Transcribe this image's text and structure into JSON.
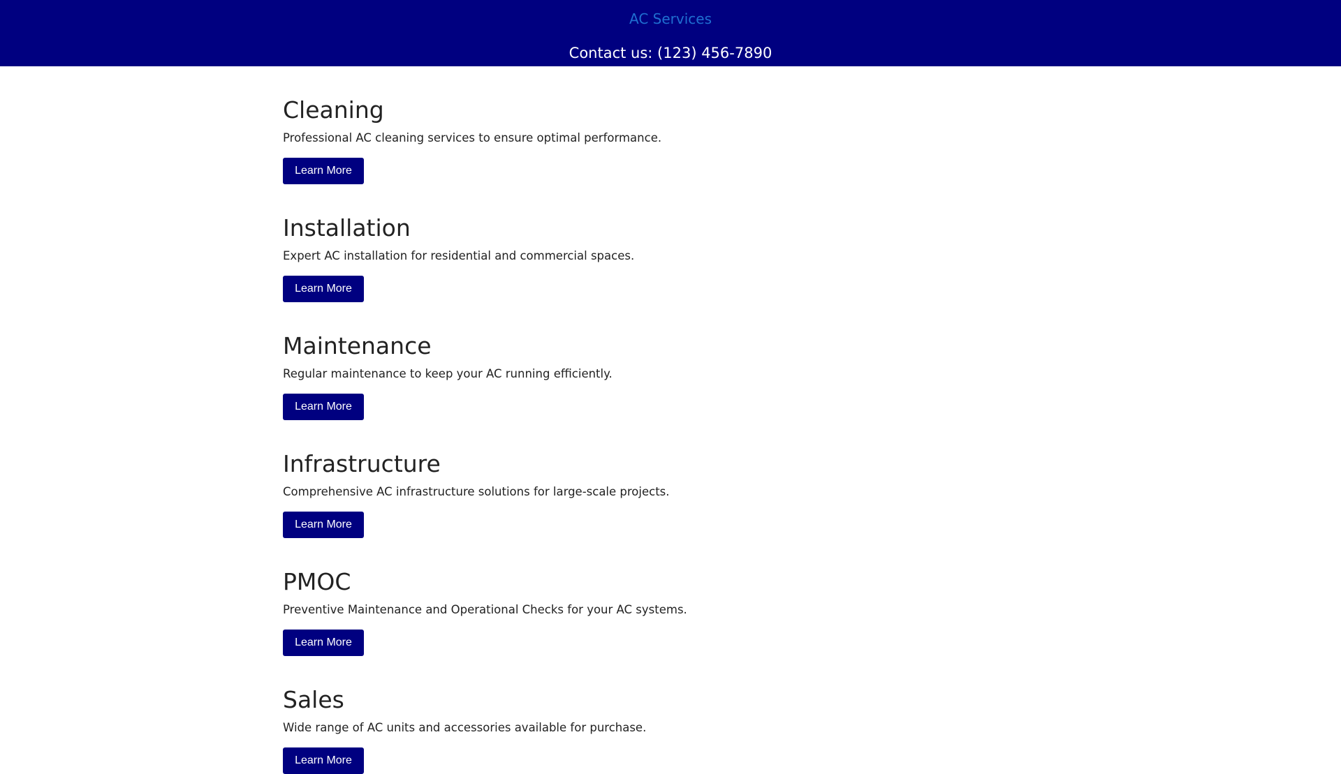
{
  "header": {
    "brand": "AC Services",
    "contact": "Contact us: (123) 456-7890"
  },
  "colors": {
    "header_bg": "#000080",
    "brand_link": "#1f6fd1",
    "button_bg": "#000080",
    "text": "#222222"
  },
  "services": [
    {
      "title": "Cleaning",
      "description": "Professional AC cleaning services to ensure optimal performance.",
      "button_label": "Learn More"
    },
    {
      "title": "Installation",
      "description": "Expert AC installation for residential and commercial spaces.",
      "button_label": "Learn More"
    },
    {
      "title": "Maintenance",
      "description": "Regular maintenance to keep your AC running efficiently.",
      "button_label": "Learn More"
    },
    {
      "title": "Infrastructure",
      "description": "Comprehensive AC infrastructure solutions for large-scale projects.",
      "button_label": "Learn More"
    },
    {
      "title": "PMOC",
      "description": "Preventive Maintenance and Operational Checks for your AC systems.",
      "button_label": "Learn More"
    },
    {
      "title": "Sales",
      "description": "Wide range of AC units and accessories available for purchase.",
      "button_label": "Learn More"
    }
  ]
}
